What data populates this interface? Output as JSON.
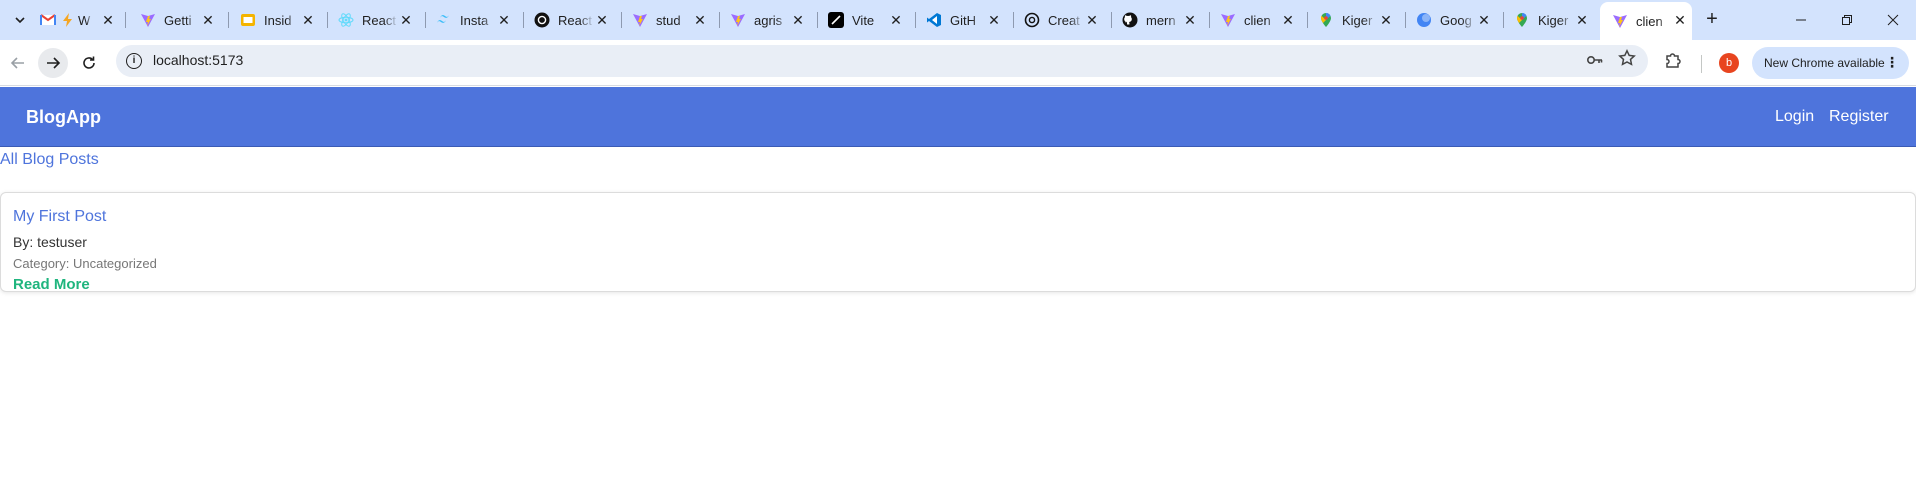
{
  "browser": {
    "tabs": [
      {
        "title": "W",
        "favicon": "gmail-icon",
        "color": "#ea4335"
      },
      {
        "title": "Getti",
        "favicon": "vite-icon",
        "color": "#9b6cff"
      },
      {
        "title": "Insid",
        "favicon": "slides-icon",
        "color": "#f4b400"
      },
      {
        "title": "React",
        "favicon": "react-icon",
        "color": "#61dafb"
      },
      {
        "title": "Insta",
        "favicon": "tailwind-icon",
        "color": "#38bdf8"
      },
      {
        "title": "React",
        "favicon": "openai-icon",
        "color": "#111111"
      },
      {
        "title": "stud",
        "favicon": "vite-icon",
        "color": "#9b6cff"
      },
      {
        "title": "agris",
        "favicon": "vite-icon",
        "color": "#9b6cff"
      },
      {
        "title": "Vite",
        "favicon": "vercel-icon",
        "color": "#000000"
      },
      {
        "title": "GitH",
        "favicon": "vscode-icon",
        "color": "#0078d4"
      },
      {
        "title": "Creat",
        "favicon": "openai-icon",
        "color": "#111111"
      },
      {
        "title": "mern",
        "favicon": "github-icon",
        "color": "#111111"
      },
      {
        "title": "clien",
        "favicon": "vite-icon",
        "color": "#9b6cff"
      },
      {
        "title": "Kiger",
        "favicon": "maps-icon",
        "color": "#34a853"
      },
      {
        "title": "Goog",
        "favicon": "gemini-icon",
        "color": "#4285f4"
      },
      {
        "title": "Kiger",
        "favicon": "maps-icon",
        "color": "#34a853"
      },
      {
        "title": "clien",
        "favicon": "vite-icon",
        "color": "#9b6cff",
        "active": true
      }
    ],
    "url": "localhost:5173",
    "profile_initial": "b",
    "update_label": "New Chrome available"
  },
  "app": {
    "brand": "BlogApp",
    "nav": {
      "login": "Login",
      "register": "Register"
    },
    "heading": "All Blog Posts",
    "posts": [
      {
        "title": "My First Post",
        "author": "By: testuser",
        "category": "Category: Uncategorized",
        "read_more": "Read More"
      }
    ],
    "colors": {
      "accent": "#4e74dc",
      "read_more": "#1fb57e"
    }
  }
}
